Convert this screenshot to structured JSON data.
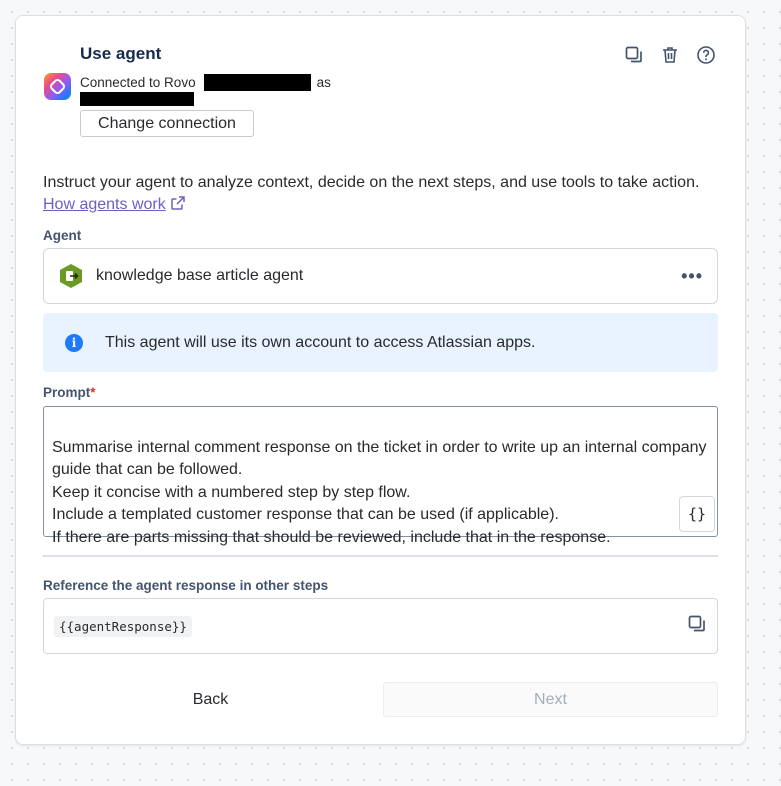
{
  "header": {
    "title": "Use agent",
    "connected_prefix": "Connected to Rovo",
    "connected_suffix": "as",
    "change_connection_label": "Change connection"
  },
  "intro": {
    "text": "Instruct your agent to analyze context, decide on the next steps, and use tools to take action.",
    "link_label": "How agents work"
  },
  "agent": {
    "label": "Agent",
    "name": "knowledge base article agent",
    "more_label": "•••"
  },
  "info": {
    "icon_glyph": "i",
    "text": "This agent will use its own account to access Atlassian apps."
  },
  "prompt": {
    "label": "Prompt",
    "required_marker": "*",
    "value": "Summarise internal comment response on the ticket in order to write up an internal company guide that can be followed.\nKeep it concise with a numbered step by step flow.\nInclude a templated customer response that can be used (if applicable).\nIf there are parts missing that should be reviewed, include that in the response.",
    "insert_variable_label": "{}"
  },
  "reference": {
    "label": "Reference the agent response in other steps",
    "variable": "{{agentResponse}}"
  },
  "footer": {
    "back_label": "Back",
    "next_label": "Next"
  },
  "icons": {
    "top": [
      "copy-icon",
      "trash-icon",
      "help-icon"
    ],
    "ref": "copy-icon"
  },
  "colors": {
    "link": "#6e5dc6",
    "info_bg": "#e9f2ff",
    "info_icon": "#1d7afc",
    "required": "#c9372c",
    "agent_icon": "#6a9a23"
  }
}
